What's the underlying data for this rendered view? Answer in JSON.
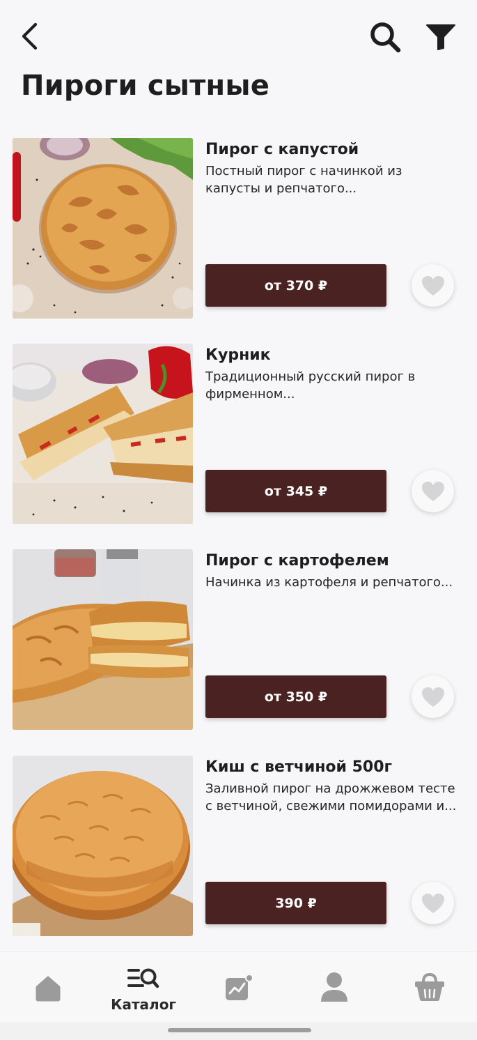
{
  "header": {
    "title": "Пироги сытные",
    "back_icon": "back-arrow-icon",
    "search_icon": "search-icon",
    "filter_icon": "filter-icon"
  },
  "products": [
    {
      "name": "Пирог с капустой",
      "description": "Постный пирог с начинкой из капусты и репчатого...",
      "price": "от 370 ₽",
      "image": "cabbage-pie-photo"
    },
    {
      "name": "Курник",
      "description": "Традиционный русский пирог в фирменном...",
      "price": "от 345 ₽",
      "image": "kurnik-pie-photo"
    },
    {
      "name": "Пирог с картофелем",
      "description": "Начинка из картофеля и репчатого...",
      "price": "от 350 ₽",
      "image": "potato-pie-photo"
    },
    {
      "name": "Киш с ветчиной 500г",
      "description": "Заливной пирог на дрожжевом тесте с ветчиной, свежими помидорами и...",
      "price": "390 ₽",
      "image": "quiche-ham-photo"
    }
  ],
  "bottom_nav": {
    "items": [
      {
        "id": "home",
        "label": "",
        "icon": "home-icon"
      },
      {
        "id": "catalog",
        "label": "Каталог",
        "icon": "catalog-search-icon",
        "active": true
      },
      {
        "id": "promo",
        "label": "",
        "icon": "promo-chart-icon"
      },
      {
        "id": "profile",
        "label": "",
        "icon": "profile-icon"
      },
      {
        "id": "cart",
        "label": "",
        "icon": "basket-icon"
      }
    ]
  },
  "colors": {
    "background": "#f7f6f8",
    "accent": "#4a2221",
    "text": "#1e1e1e",
    "icon_inactive": "#9b9b9b",
    "favorite_icon": "#d5d5d8"
  }
}
